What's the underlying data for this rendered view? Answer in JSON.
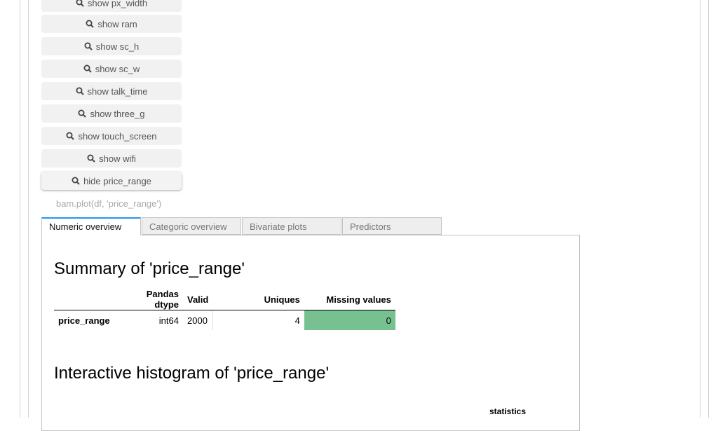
{
  "buttons": {
    "px_width": "show px_width",
    "ram": "show ram",
    "sc_h": "show sc_h",
    "sc_w": "show sc_w",
    "talk_time": "show talk_time",
    "three_g": "show three_g",
    "touch_screen": "show touch_screen",
    "wifi": "show wifi",
    "price_range": "hide price_range"
  },
  "caption": "bam.plot(df, 'price_range')",
  "tabs": [
    "Numeric overview",
    "Categoric overview",
    "Bivariate plots",
    "Predictors"
  ],
  "summary": {
    "title": "Summary of 'price_range'",
    "headers": [
      "",
      "Pandas dtype",
      "Valid",
      "",
      "Uniques",
      "Missing values"
    ],
    "row": {
      "name": "price_range",
      "dtype": "int64",
      "valid": "2000",
      "uniques": "4",
      "missing": "0"
    },
    "missing_color": "#77c190"
  },
  "histogram": {
    "title": "Interactive histogram of 'price_range'",
    "statistics_label": "statistics"
  },
  "icons": {
    "button_icon": "search-icon"
  }
}
